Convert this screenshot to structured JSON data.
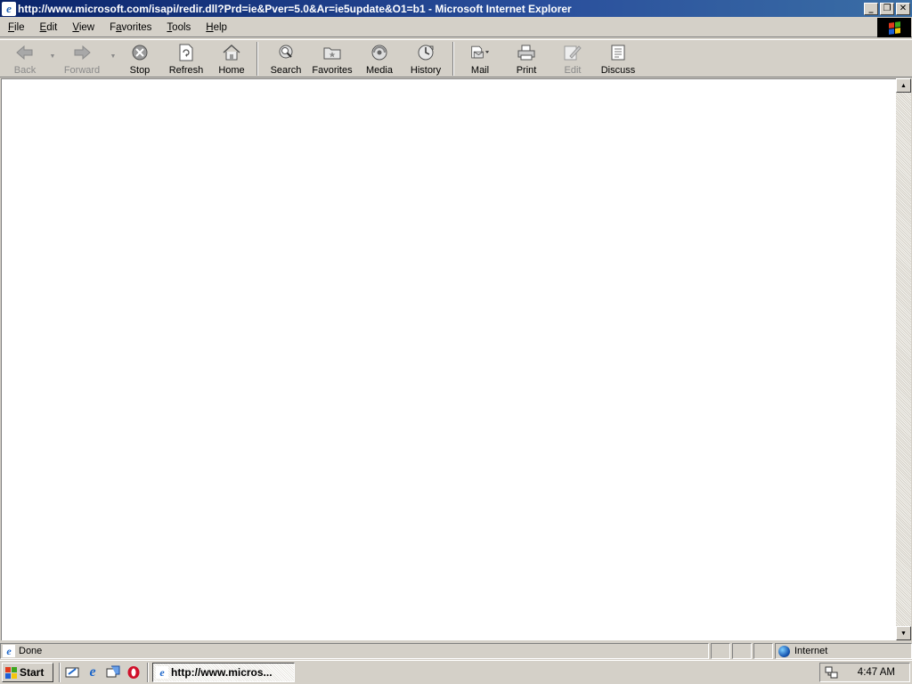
{
  "window": {
    "title": "http://www.microsoft.com/isapi/redir.dll?Prd=ie&Pver=5.0&Ar=ie5update&O1=b1 - Microsoft Internet Explorer",
    "buttons": {
      "minimize": "_",
      "maximize": "❐",
      "close": "✕"
    }
  },
  "menu": {
    "items": [
      {
        "label": "File",
        "accel": "F",
        "rest": "ile"
      },
      {
        "label": "Edit",
        "accel": "E",
        "rest": "dit"
      },
      {
        "label": "View",
        "accel": "V",
        "rest": "iew"
      },
      {
        "label": "Favorites",
        "accel": "a",
        "pre": "F",
        "rest": "vorites"
      },
      {
        "label": "Tools",
        "accel": "T",
        "rest": "ools"
      },
      {
        "label": "Help",
        "accel": "H",
        "rest": "elp"
      }
    ]
  },
  "toolbar": {
    "back": "Back",
    "forward": "Forward",
    "stop": "Stop",
    "refresh": "Refresh",
    "home": "Home",
    "search": "Search",
    "favorites": "Favorites",
    "media": "Media",
    "history": "History",
    "mail": "Mail",
    "print": "Print",
    "edit": "Edit",
    "discuss": "Discuss"
  },
  "status": {
    "text": "Done",
    "zone": "Internet"
  },
  "taskbar": {
    "start_label": "Start",
    "task_label": "http://www.micros...",
    "clock": "4:47 AM"
  },
  "colors": {
    "titlebar_start": "#0a246a",
    "titlebar_end": "#3a6ea5",
    "chrome": "#d4d0c8"
  }
}
